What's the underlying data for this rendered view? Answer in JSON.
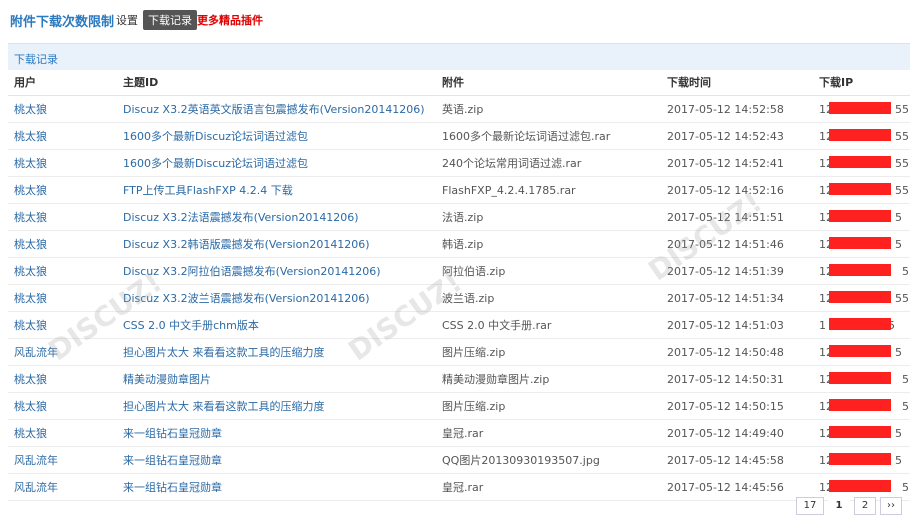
{
  "header": {
    "title": "附件下载次数限制",
    "nav": {
      "settings": "设置",
      "records": "下载记录",
      "more": "更多精品插件"
    }
  },
  "section": {
    "title": "下载记录"
  },
  "table": {
    "columns": [
      "用户",
      "主题ID",
      "附件",
      "下载时间",
      "下载IP"
    ],
    "rows": [
      {
        "user": "桃太狼",
        "subject": "Discuz X3.2英语英文版语言包震撼发布(Version20141206)",
        "attachment": "英语.zip",
        "time": "2017-05-12 14:52:58",
        "ip_prefix": "12",
        "ip_suffix": "55"
      },
      {
        "user": "桃太狼",
        "subject": "1600多个最新Discuz论坛词语过滤包",
        "attachment": "1600多个最新论坛词语过滤包.rar",
        "time": "2017-05-12 14:52:43",
        "ip_prefix": "12",
        "ip_suffix": "55"
      },
      {
        "user": "桃太狼",
        "subject": "1600多个最新Discuz论坛词语过滤包",
        "attachment": "240个论坛常用词语过滤.rar",
        "time": "2017-05-12 14:52:41",
        "ip_prefix": "12",
        "ip_suffix": "55"
      },
      {
        "user": "桃太狼",
        "subject": "FTP上传工具FlashFXP 4.2.4 下载",
        "attachment": "FlashFXP_4.2.4.1785.rar",
        "time": "2017-05-12 14:52:16",
        "ip_prefix": "12",
        "ip_suffix": "55"
      },
      {
        "user": "桃太狼",
        "subject": "Discuz X3.2法语震撼发布(Version20141206)",
        "attachment": "法语.zip",
        "time": "2017-05-12 14:51:51",
        "ip_prefix": "12",
        "ip_suffix": "5"
      },
      {
        "user": "桃太狼",
        "subject": "Discuz X3.2韩语版震撼发布(Version20141206)",
        "attachment": "韩语.zip",
        "time": "2017-05-12 14:51:46",
        "ip_prefix": "12",
        "ip_suffix": "5"
      },
      {
        "user": "桃太狼",
        "subject": "Discuz X3.2阿拉伯语震撼发布(Version20141206)",
        "attachment": "阿拉伯语.zip",
        "time": "2017-05-12 14:51:39",
        "ip_prefix": "127",
        "ip_suffix": "55"
      },
      {
        "user": "桃太狼",
        "subject": "Discuz X3.2波兰语震撼发布(Version20141206)",
        "attachment": "波兰语.zip",
        "time": "2017-05-12 14:51:34",
        "ip_prefix": "12",
        "ip_suffix": "55"
      },
      {
        "user": "桃太狼",
        "subject": "CSS 2.0 中文手册chm版本",
        "attachment": "CSS 2.0 中文手册.rar",
        "time": "2017-05-12 14:51:03",
        "ip_prefix": "1",
        "ip_suffix": "5"
      },
      {
        "user": "风乱流年",
        "subject": "担心图片太大 来看看这款工具的压缩力度",
        "attachment": "图片压缩.zip",
        "time": "2017-05-12 14:50:48",
        "ip_prefix": "12",
        "ip_suffix": "5"
      },
      {
        "user": "桃太狼",
        "subject": "精美动漫勋章图片",
        "attachment": "精美动漫勋章图片.zip",
        "time": "2017-05-12 14:50:31",
        "ip_prefix": "127",
        "ip_suffix": "5"
      },
      {
        "user": "桃太狼",
        "subject": "担心图片太大 来看看这款工具的压缩力度",
        "attachment": "图片压缩.zip",
        "time": "2017-05-12 14:50:15",
        "ip_prefix": "127",
        "ip_suffix": "5"
      },
      {
        "user": "桃太狼",
        "subject": "来一组钻石皇冠勋章",
        "attachment": "皇冠.rar",
        "time": "2017-05-12 14:49:40",
        "ip_prefix": "12",
        "ip_suffix": "5"
      },
      {
        "user": "风乱流年",
        "subject": "来一组钻石皇冠勋章",
        "attachment": "QQ图片20130930193507.jpg",
        "time": "2017-05-12 14:45:58",
        "ip_prefix": "12",
        "ip_suffix": "5"
      },
      {
        "user": "风乱流年",
        "subject": "来一组钻石皇冠勋章",
        "attachment": "皇冠.rar",
        "time": "2017-05-12 14:45:56",
        "ip_prefix": "127",
        "ip_suffix": "5"
      }
    ]
  },
  "pager": {
    "total": "17",
    "current": "1",
    "next_page": "2",
    "next": "››"
  },
  "colors": {
    "accent": "#2b7ac0",
    "link": "#2b6aa5",
    "alert": "#e00000",
    "mask": "#ff2020"
  }
}
